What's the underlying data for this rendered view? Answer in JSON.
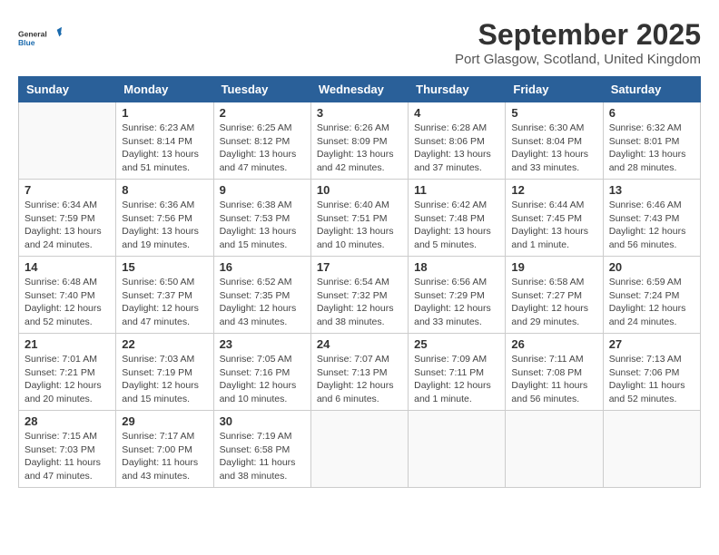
{
  "logo": {
    "text_general": "General",
    "text_blue": "Blue"
  },
  "title": "September 2025",
  "location": "Port Glasgow, Scotland, United Kingdom",
  "weekdays": [
    "Sunday",
    "Monday",
    "Tuesday",
    "Wednesday",
    "Thursday",
    "Friday",
    "Saturday"
  ],
  "weeks": [
    [
      {
        "day": "",
        "info": ""
      },
      {
        "day": "1",
        "info": "Sunrise: 6:23 AM\nSunset: 8:14 PM\nDaylight: 13 hours\nand 51 minutes."
      },
      {
        "day": "2",
        "info": "Sunrise: 6:25 AM\nSunset: 8:12 PM\nDaylight: 13 hours\nand 47 minutes."
      },
      {
        "day": "3",
        "info": "Sunrise: 6:26 AM\nSunset: 8:09 PM\nDaylight: 13 hours\nand 42 minutes."
      },
      {
        "day": "4",
        "info": "Sunrise: 6:28 AM\nSunset: 8:06 PM\nDaylight: 13 hours\nand 37 minutes."
      },
      {
        "day": "5",
        "info": "Sunrise: 6:30 AM\nSunset: 8:04 PM\nDaylight: 13 hours\nand 33 minutes."
      },
      {
        "day": "6",
        "info": "Sunrise: 6:32 AM\nSunset: 8:01 PM\nDaylight: 13 hours\nand 28 minutes."
      }
    ],
    [
      {
        "day": "7",
        "info": "Sunrise: 6:34 AM\nSunset: 7:59 PM\nDaylight: 13 hours\nand 24 minutes."
      },
      {
        "day": "8",
        "info": "Sunrise: 6:36 AM\nSunset: 7:56 PM\nDaylight: 13 hours\nand 19 minutes."
      },
      {
        "day": "9",
        "info": "Sunrise: 6:38 AM\nSunset: 7:53 PM\nDaylight: 13 hours\nand 15 minutes."
      },
      {
        "day": "10",
        "info": "Sunrise: 6:40 AM\nSunset: 7:51 PM\nDaylight: 13 hours\nand 10 minutes."
      },
      {
        "day": "11",
        "info": "Sunrise: 6:42 AM\nSunset: 7:48 PM\nDaylight: 13 hours\nand 5 minutes."
      },
      {
        "day": "12",
        "info": "Sunrise: 6:44 AM\nSunset: 7:45 PM\nDaylight: 13 hours\nand 1 minute."
      },
      {
        "day": "13",
        "info": "Sunrise: 6:46 AM\nSunset: 7:43 PM\nDaylight: 12 hours\nand 56 minutes."
      }
    ],
    [
      {
        "day": "14",
        "info": "Sunrise: 6:48 AM\nSunset: 7:40 PM\nDaylight: 12 hours\nand 52 minutes."
      },
      {
        "day": "15",
        "info": "Sunrise: 6:50 AM\nSunset: 7:37 PM\nDaylight: 12 hours\nand 47 minutes."
      },
      {
        "day": "16",
        "info": "Sunrise: 6:52 AM\nSunset: 7:35 PM\nDaylight: 12 hours\nand 43 minutes."
      },
      {
        "day": "17",
        "info": "Sunrise: 6:54 AM\nSunset: 7:32 PM\nDaylight: 12 hours\nand 38 minutes."
      },
      {
        "day": "18",
        "info": "Sunrise: 6:56 AM\nSunset: 7:29 PM\nDaylight: 12 hours\nand 33 minutes."
      },
      {
        "day": "19",
        "info": "Sunrise: 6:58 AM\nSunset: 7:27 PM\nDaylight: 12 hours\nand 29 minutes."
      },
      {
        "day": "20",
        "info": "Sunrise: 6:59 AM\nSunset: 7:24 PM\nDaylight: 12 hours\nand 24 minutes."
      }
    ],
    [
      {
        "day": "21",
        "info": "Sunrise: 7:01 AM\nSunset: 7:21 PM\nDaylight: 12 hours\nand 20 minutes."
      },
      {
        "day": "22",
        "info": "Sunrise: 7:03 AM\nSunset: 7:19 PM\nDaylight: 12 hours\nand 15 minutes."
      },
      {
        "day": "23",
        "info": "Sunrise: 7:05 AM\nSunset: 7:16 PM\nDaylight: 12 hours\nand 10 minutes."
      },
      {
        "day": "24",
        "info": "Sunrise: 7:07 AM\nSunset: 7:13 PM\nDaylight: 12 hours\nand 6 minutes."
      },
      {
        "day": "25",
        "info": "Sunrise: 7:09 AM\nSunset: 7:11 PM\nDaylight: 12 hours\nand 1 minute."
      },
      {
        "day": "26",
        "info": "Sunrise: 7:11 AM\nSunset: 7:08 PM\nDaylight: 11 hours\nand 56 minutes."
      },
      {
        "day": "27",
        "info": "Sunrise: 7:13 AM\nSunset: 7:06 PM\nDaylight: 11 hours\nand 52 minutes."
      }
    ],
    [
      {
        "day": "28",
        "info": "Sunrise: 7:15 AM\nSunset: 7:03 PM\nDaylight: 11 hours\nand 47 minutes."
      },
      {
        "day": "29",
        "info": "Sunrise: 7:17 AM\nSunset: 7:00 PM\nDaylight: 11 hours\nand 43 minutes."
      },
      {
        "day": "30",
        "info": "Sunrise: 7:19 AM\nSunset: 6:58 PM\nDaylight: 11 hours\nand 38 minutes."
      },
      {
        "day": "",
        "info": ""
      },
      {
        "day": "",
        "info": ""
      },
      {
        "day": "",
        "info": ""
      },
      {
        "day": "",
        "info": ""
      }
    ]
  ]
}
